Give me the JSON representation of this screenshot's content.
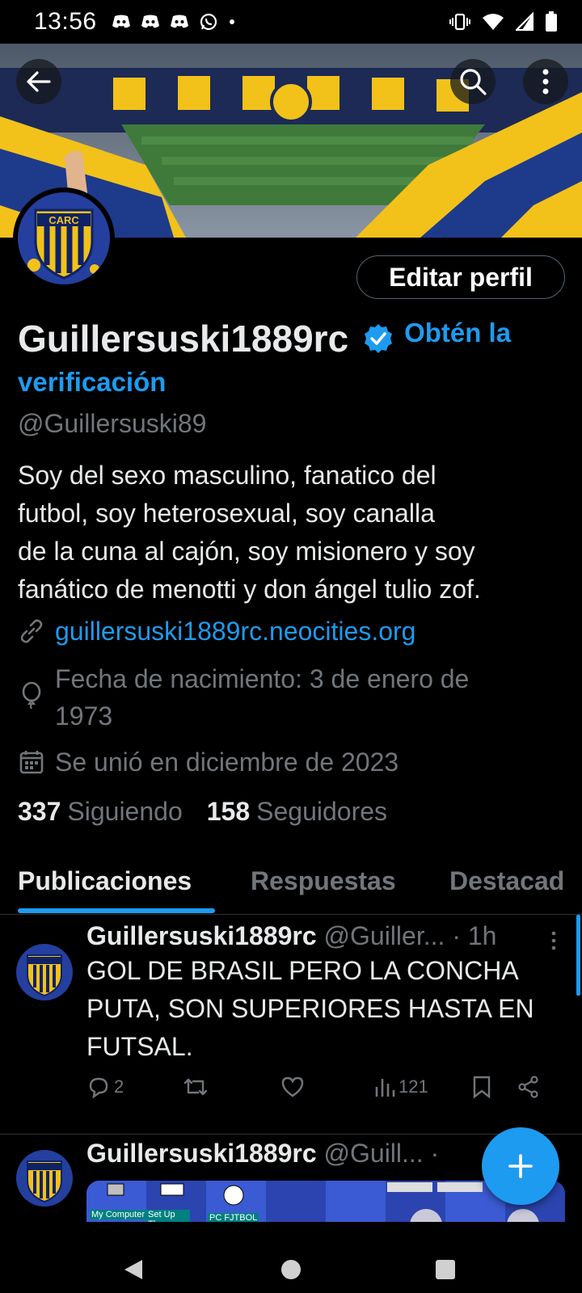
{
  "status_bar": {
    "time": "13:56"
  },
  "banner": {
    "badge_text": "CARC"
  },
  "profile": {
    "edit_button": "Editar perfil",
    "display_name": "Guillersuski1889rc",
    "verify_cta": "Obtén la verificación",
    "handle": "@Guillersuski89",
    "bio": "Soy del sexo masculino, fanatico del\nfutbol, soy heterosexual, soy canalla\nde la cuna al cajón, soy misionero y soy\nfanático de menotti y don ángel tulio zof.",
    "website": "guillersuski1889rc.neocities.org",
    "birthdate_line1": "Fecha de nacimiento: 3 de enero de",
    "birthdate_line2": "1973",
    "joined": "Se unió en diciembre de 2023",
    "following_count": "337",
    "following_label": "Siguiendo",
    "followers_count": "158",
    "followers_label": "Seguidores"
  },
  "tabs": [
    "Publicaciones",
    "Respuestas",
    "Destacad"
  ],
  "posts": [
    {
      "name": "Guillersuski1889rc",
      "handle": "@Guiller...",
      "time": "· 1h",
      "text": "GOL DE BRASIL PERO LA CONCHA PUTA, SON SUPERIORES HASTA EN FUTSAL.",
      "replies": "2",
      "views": "121"
    },
    {
      "name": "Guillersuski1889rc",
      "handle": "@Guill...",
      "time": "·",
      "media_labels": [
        "My Computer",
        "Set Up The Microsoft",
        "PC FJTBOL"
      ]
    }
  ],
  "colors": {
    "accent": "#1d9bf0",
    "gold": "#f2c21a",
    "navy": "#1e3a8a",
    "muted": "#71767b"
  }
}
